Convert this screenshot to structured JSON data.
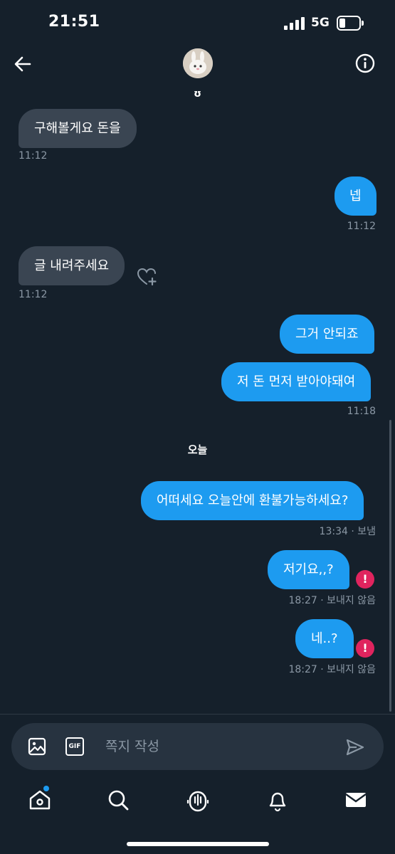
{
  "status_bar": {
    "time": "21:51",
    "network": "5G"
  },
  "header": {
    "name": "ʊ"
  },
  "messages": [
    {
      "text": "구해볼게요 돈을",
      "time": "11:12"
    },
    {
      "text": "넵",
      "time": "11:12"
    },
    {
      "text": "글 내려주세요",
      "time": "11:12"
    },
    {
      "text": "그거 안되죠"
    },
    {
      "text": "저 돈 먼저 받아야돼여",
      "time": "11:18"
    },
    {
      "text": "어떠세요 오늘안에 환불가능하세요?",
      "time": "13:34 · 보냄"
    },
    {
      "text": "저기요,,?",
      "time": "18:27 · 보내지 않음"
    },
    {
      "text": "네..?",
      "time": "18:27 · 보내지 않음"
    }
  ],
  "day_separator": "오늘",
  "error_symbol": "!",
  "composer": {
    "placeholder": "쪽지 작성",
    "gif_label": "GIF"
  },
  "tabs": [
    "home-icon",
    "search-icon",
    "spaces-icon",
    "notifications-icon",
    "messages-icon"
  ],
  "colors": {
    "background": "#15202b",
    "outgoing": "#1d9bf0",
    "incoming": "#3a4552",
    "error": "#e0245e"
  }
}
